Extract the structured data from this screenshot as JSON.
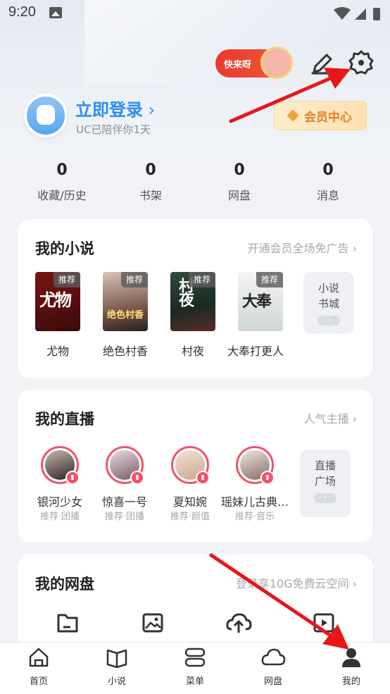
{
  "status": {
    "time": "9:20"
  },
  "header": {
    "promo_label": "快来呀",
    "login_title": "立即登录",
    "login_sub": "UC已陪伴你1天",
    "vip_label": "会员中心"
  },
  "stats": [
    {
      "num": "0",
      "label": "收藏/历史"
    },
    {
      "num": "0",
      "label": "书架"
    },
    {
      "num": "0",
      "label": "网盘"
    },
    {
      "num": "0",
      "label": "消息"
    }
  ],
  "novels": {
    "title": "我的小说",
    "link": "开通会员全场免广告",
    "tag": "推荐",
    "books": [
      {
        "name": "尤物",
        "cover": "尤物"
      },
      {
        "name": "绝色村香",
        "cover": "绝色村香"
      },
      {
        "name": "村夜",
        "cover": "村夜"
      },
      {
        "name": "大奉打更人",
        "cover": "大奉"
      }
    ],
    "more_label_1": "小说",
    "more_label_2": "书城"
  },
  "live": {
    "title": "我的直播",
    "link": "人气主播",
    "streamers": [
      {
        "name": "银河少女",
        "sub": "推荐·团播"
      },
      {
        "name": "惊喜一号",
        "sub": "推荐·团播"
      },
      {
        "name": "夏知婉",
        "sub": "推荐·颜值"
      },
      {
        "name": "瑶妹儿古典…",
        "sub": "推荐·音乐"
      }
    ],
    "more_label_1": "直播",
    "more_label_2": "广场"
  },
  "disk": {
    "title": "我的网盘",
    "link": "登录享10G免费云空间"
  },
  "nav": [
    {
      "label": "首页"
    },
    {
      "label": "小说"
    },
    {
      "label": "菜单"
    },
    {
      "label": "网盘"
    },
    {
      "label": "我的"
    }
  ],
  "colors": {
    "accent": "#2a8ff0",
    "vip": "#e0822a",
    "live": "#f4506a",
    "arrow": "#e8161b"
  }
}
